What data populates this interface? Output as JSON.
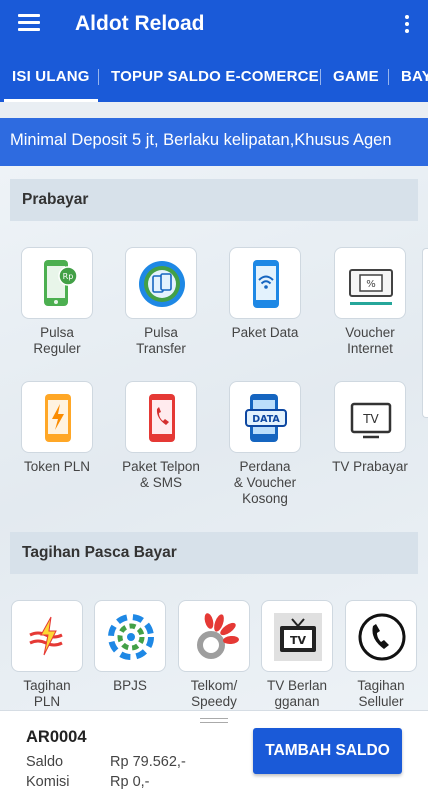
{
  "app": {
    "title": "Aldot Reload"
  },
  "tabs": [
    {
      "label": "ISI ULANG"
    },
    {
      "label": "TOPUP SALDO E-COMERCE"
    },
    {
      "label": "GAME"
    },
    {
      "label": "BAY"
    }
  ],
  "marquee": {
    "text": "Minimal Deposit 5 jt, Berlaku kelipatan,Khusus Agen"
  },
  "prabayar": {
    "title": "Prabayar",
    "items": [
      {
        "label": "Pulsa\nReguler",
        "icon": "pulsa-reguler-icon"
      },
      {
        "label": "Pulsa\nTransfer",
        "icon": "pulsa-transfer-icon"
      },
      {
        "label": "Paket Data",
        "icon": "paket-data-icon"
      },
      {
        "label": "Voucher\nInternet",
        "icon": "voucher-internet-icon"
      },
      {
        "label": "Token PLN",
        "icon": "token-pln-icon"
      },
      {
        "label": "Paket Telpon\n& SMS",
        "icon": "paket-telpon-icon"
      },
      {
        "label": "Perdana\n& Voucher\nKosong",
        "icon": "perdana-data-icon"
      },
      {
        "label": "TV Prabayar",
        "icon": "tv-prabayar-icon"
      }
    ]
  },
  "pascabayar": {
    "title": "Tagihan Pasca Bayar",
    "items": [
      {
        "label": "Tagihan\nPLN",
        "icon": "pln-logo-icon"
      },
      {
        "label": "BPJS",
        "icon": "bpjs-logo-icon"
      },
      {
        "label": "Telkom/\nSpeedy",
        "icon": "telkom-logo-icon"
      },
      {
        "label": "TV Berlan\ngganan",
        "icon": "tv-berlangganan-icon"
      },
      {
        "label": "Tagihan\nSelluler",
        "icon": "phone-icon"
      }
    ]
  },
  "account": {
    "id": "AR0004",
    "saldo_label": "Saldo",
    "saldo_value": "Rp 79.562,-",
    "komisi_label": "Komisi",
    "komisi_value": "Rp 0,-",
    "topup_label": "TAMBAH SALDO"
  },
  "colors": {
    "primary": "#1a5ad8",
    "marquee": "#2e6be0"
  }
}
